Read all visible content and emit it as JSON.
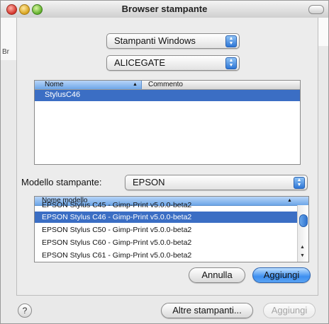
{
  "window": {
    "title": "Browser stampante"
  },
  "background": {
    "partial_label": "Br"
  },
  "sheet": {
    "printer_type_popup": "Stampanti Windows",
    "workgroup_popup": "ALICEGATE",
    "printer_list": {
      "columns": [
        "Nome",
        "Commento"
      ],
      "sort_indicator": "▲",
      "rows": [
        {
          "name": "StylusC46",
          "comment": "",
          "selected": true
        }
      ]
    },
    "model_label": "Modello stampante:",
    "model_popup": "EPSON",
    "model_list": {
      "header": "Nome modello",
      "sort_indicator": "▲",
      "rows": [
        {
          "label": "EPSON Stylus C45 - Gimp-Print v5.0.0-beta2",
          "selected": false
        },
        {
          "label": "EPSON Stylus C46 - Gimp-Print v5.0.0-beta2",
          "selected": true
        },
        {
          "label": "EPSON Stylus C50 - Gimp-Print v5.0.0-beta2",
          "selected": false
        },
        {
          "label": "EPSON Stylus C60 - Gimp-Print v5.0.0-beta2",
          "selected": false
        },
        {
          "label": "EPSON Stylus C61 - Gimp-Print v5.0.0-beta2",
          "selected": false
        }
      ]
    },
    "cancel_label": "Annulla",
    "add_label": "Aggiungi"
  },
  "footer": {
    "help_label": "?",
    "other_printers_label": "Altre stampanti...",
    "add_label": "Aggiungi"
  },
  "colors": {
    "selection": "#3b6ec4",
    "default_button": "#3d8ff0"
  }
}
